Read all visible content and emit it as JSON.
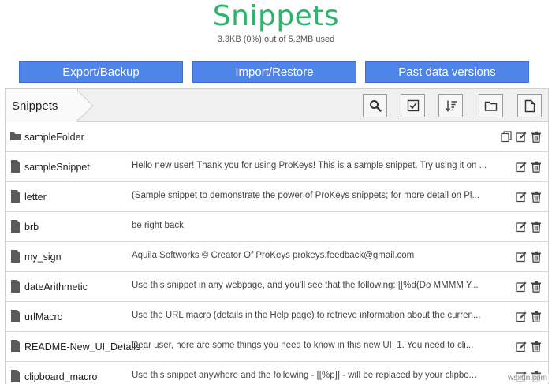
{
  "header": {
    "title": "Snippets",
    "usage": "3.3KB (0%) out of 5.2MB used"
  },
  "actions": {
    "export_label": "Export/Backup",
    "import_label": "Import/Restore",
    "past_label": "Past data versions"
  },
  "toolbar": {
    "breadcrumb": "Snippets",
    "icons": [
      "search-icon",
      "checkbox-icon",
      "sort-icon",
      "new-folder-icon",
      "new-snippet-icon"
    ]
  },
  "items": [
    {
      "type": "folder",
      "name": "sampleFolder",
      "preview": ""
    },
    {
      "type": "snippet",
      "name": "sampleSnippet",
      "preview": "Hello new user! Thank you for using ProKeys!  This is a sample snippet. Try using it on ..."
    },
    {
      "type": "snippet",
      "name": "letter",
      "preview": "(Sample snippet to demonstrate the power of ProKeys snippets; for more detail on Pl..."
    },
    {
      "type": "snippet",
      "name": "brb",
      "preview": "be right back"
    },
    {
      "type": "snippet",
      "name": "my_sign",
      "preview": "Aquila Softworks ©  Creator Of ProKeys  prokeys.feedback@gmail.com"
    },
    {
      "type": "snippet",
      "name": "dateArithmetic",
      "preview": "Use this snippet in any webpage, and you'll see that the following: [[%d(Do MMMM Y..."
    },
    {
      "type": "snippet",
      "name": "urlMacro",
      "preview": "Use the URL macro (details in the Help page) to retrieve information about the curren..."
    },
    {
      "type": "snippet",
      "name": "README-New_UI_Details",
      "preview": "Dear user, here are some things you need to know in this new UI:  1. You need to cli..."
    },
    {
      "type": "snippet",
      "name": "clipboard_macro",
      "preview": "Use this snippet anywhere and the following - [[%p]] - will be replaced by  your clipbo..."
    }
  ],
  "watermark": "wsxdn.com",
  "colors": {
    "title_green": "#2fb46e",
    "button_blue": "#4f84e8"
  }
}
